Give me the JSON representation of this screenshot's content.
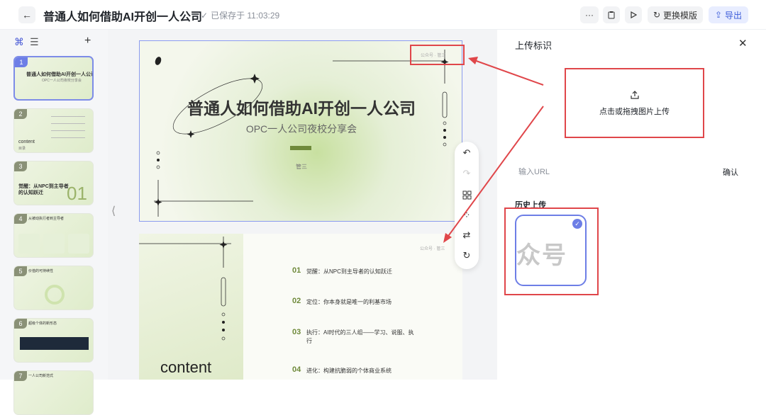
{
  "header": {
    "title": "普通人如何借助AI开创一人公司",
    "save_status": "已保存于 11:03:29",
    "more_label": "···",
    "change_template_label": "更换模版",
    "export_label": "导出"
  },
  "sidebar": {
    "slides": [
      {
        "num": "1",
        "title": "普通人如何借助AI开创一人公司",
        "sub": "OPC一人公司夜校分享会"
      },
      {
        "num": "2",
        "label": "content",
        "sub": "目录"
      },
      {
        "num": "3",
        "title": "觉醒：从NPC到主导者",
        "title2": "的认知跃迁",
        "big": "01"
      },
      {
        "num": "4",
        "title": "从被动执行者到主导者"
      },
      {
        "num": "5",
        "title": "价值的可持续性"
      },
      {
        "num": "6",
        "title": "超级个体的新形态"
      },
      {
        "num": "7",
        "title": "一人公司新范式"
      }
    ]
  },
  "slide1": {
    "title": "普通人如何借助AI开创一人公司",
    "subtitle": "OPC一人公司夜校分享会",
    "author": "管三",
    "watermark": "公众号 · 管三"
  },
  "slide2": {
    "content_word": "content",
    "watermark": "公众号 · 管三",
    "items": [
      {
        "num": "01",
        "text": "觉醒：从NPC到主导者的认知跃迁"
      },
      {
        "num": "02",
        "text": "定位：你本身就是唯一的利基市场"
      },
      {
        "num": "03",
        "text": "执行：AI时代的三人组——学习、说服、执",
        "text2": "行"
      },
      {
        "num": "04",
        "text": "进化：构建抗脆弱的个体商业系统"
      }
    ]
  },
  "right_panel": {
    "title": "上传标识",
    "upload_label": "点击或拖拽图片上传",
    "url_placeholder": "输入URL",
    "confirm_label": "确认",
    "history_title": "历史上传",
    "history_item_text": "众号"
  },
  "colors": {
    "accent": "#3a5bd9",
    "slide_green": "#6f8a3b",
    "annotation_red": "#e0464a",
    "selection": "#6d7ee6"
  }
}
